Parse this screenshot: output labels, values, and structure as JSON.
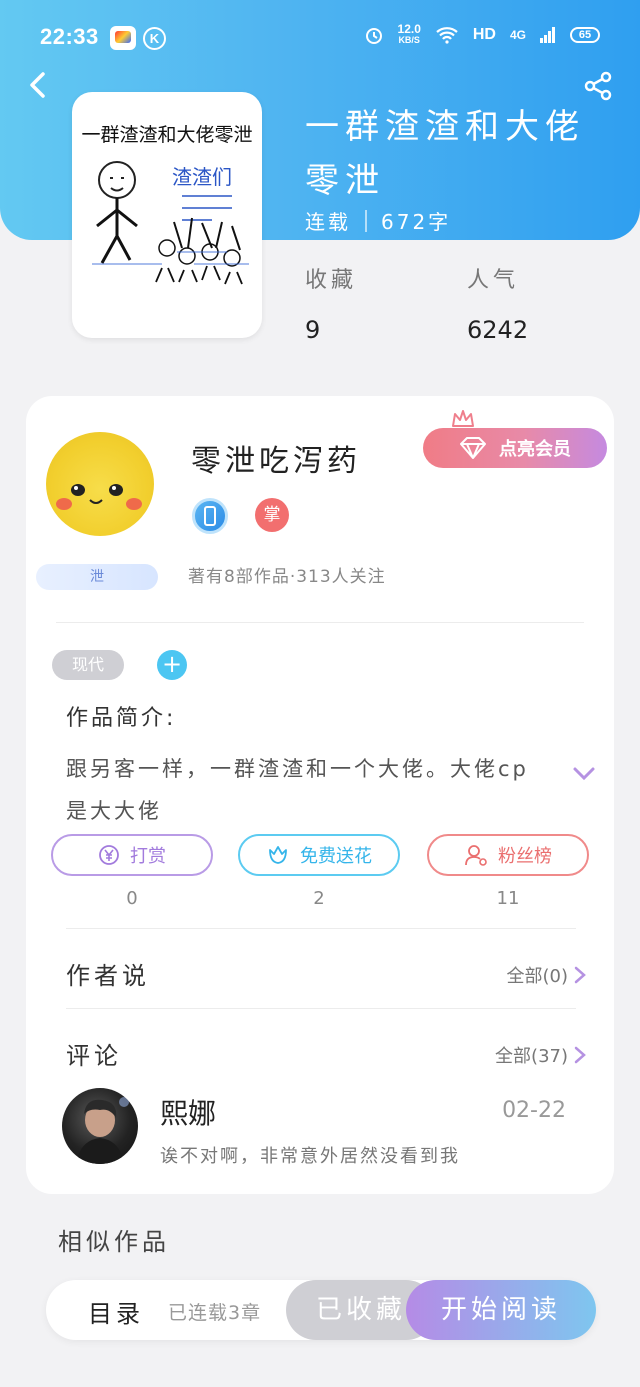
{
  "status_bar": {
    "time": "22:33",
    "app_badge": "K",
    "net_speed": "12.0",
    "net_unit": "KB/S",
    "hd": "HD",
    "signal": "4G",
    "battery": "65"
  },
  "book": {
    "cover_title": "一群渣渣和大佬零泄",
    "title": "一群渣渣和大佬零泄",
    "status": "连载",
    "word_count": "672字",
    "stats": [
      {
        "label": "收藏",
        "value": "9"
      },
      {
        "label": "人气",
        "value": "6242"
      }
    ]
  },
  "author": {
    "name": "零泄吃泻药",
    "vip_label": "点亮会员",
    "badge_text": "掌",
    "tag": "泄",
    "summary": "著有8部作品·313人关注"
  },
  "intro": {
    "genre": "现代",
    "add_symbol": "+",
    "title": "作品简介:",
    "text": "跟另客一样，一群渣渣和一个大佬。大佬cp是大大佬"
  },
  "actions": [
    {
      "label": "打赏",
      "count": "0"
    },
    {
      "label": "免费送花",
      "count": "2"
    },
    {
      "label": "粉丝榜",
      "count": "11"
    }
  ],
  "author_says": {
    "title": "作者说",
    "more": "全部(0)"
  },
  "comments": {
    "title": "评论",
    "more": "全部(37)",
    "first": {
      "user": "熙娜",
      "date": "02-22",
      "text": "诶不对啊，非常意外居然没看到我"
    }
  },
  "similar": {
    "title": "相似作品"
  },
  "bottom_bar": {
    "toc": "目录",
    "chapter_info": "已连载3章",
    "collected": "已收藏",
    "read": "开始阅读"
  },
  "colors": {
    "header_gradient_start": "#63c9f2",
    "header_gradient_end": "#2f9ff0",
    "vip_gradient_start": "#f07c86",
    "vip_gradient_end": "#c58ae0"
  }
}
